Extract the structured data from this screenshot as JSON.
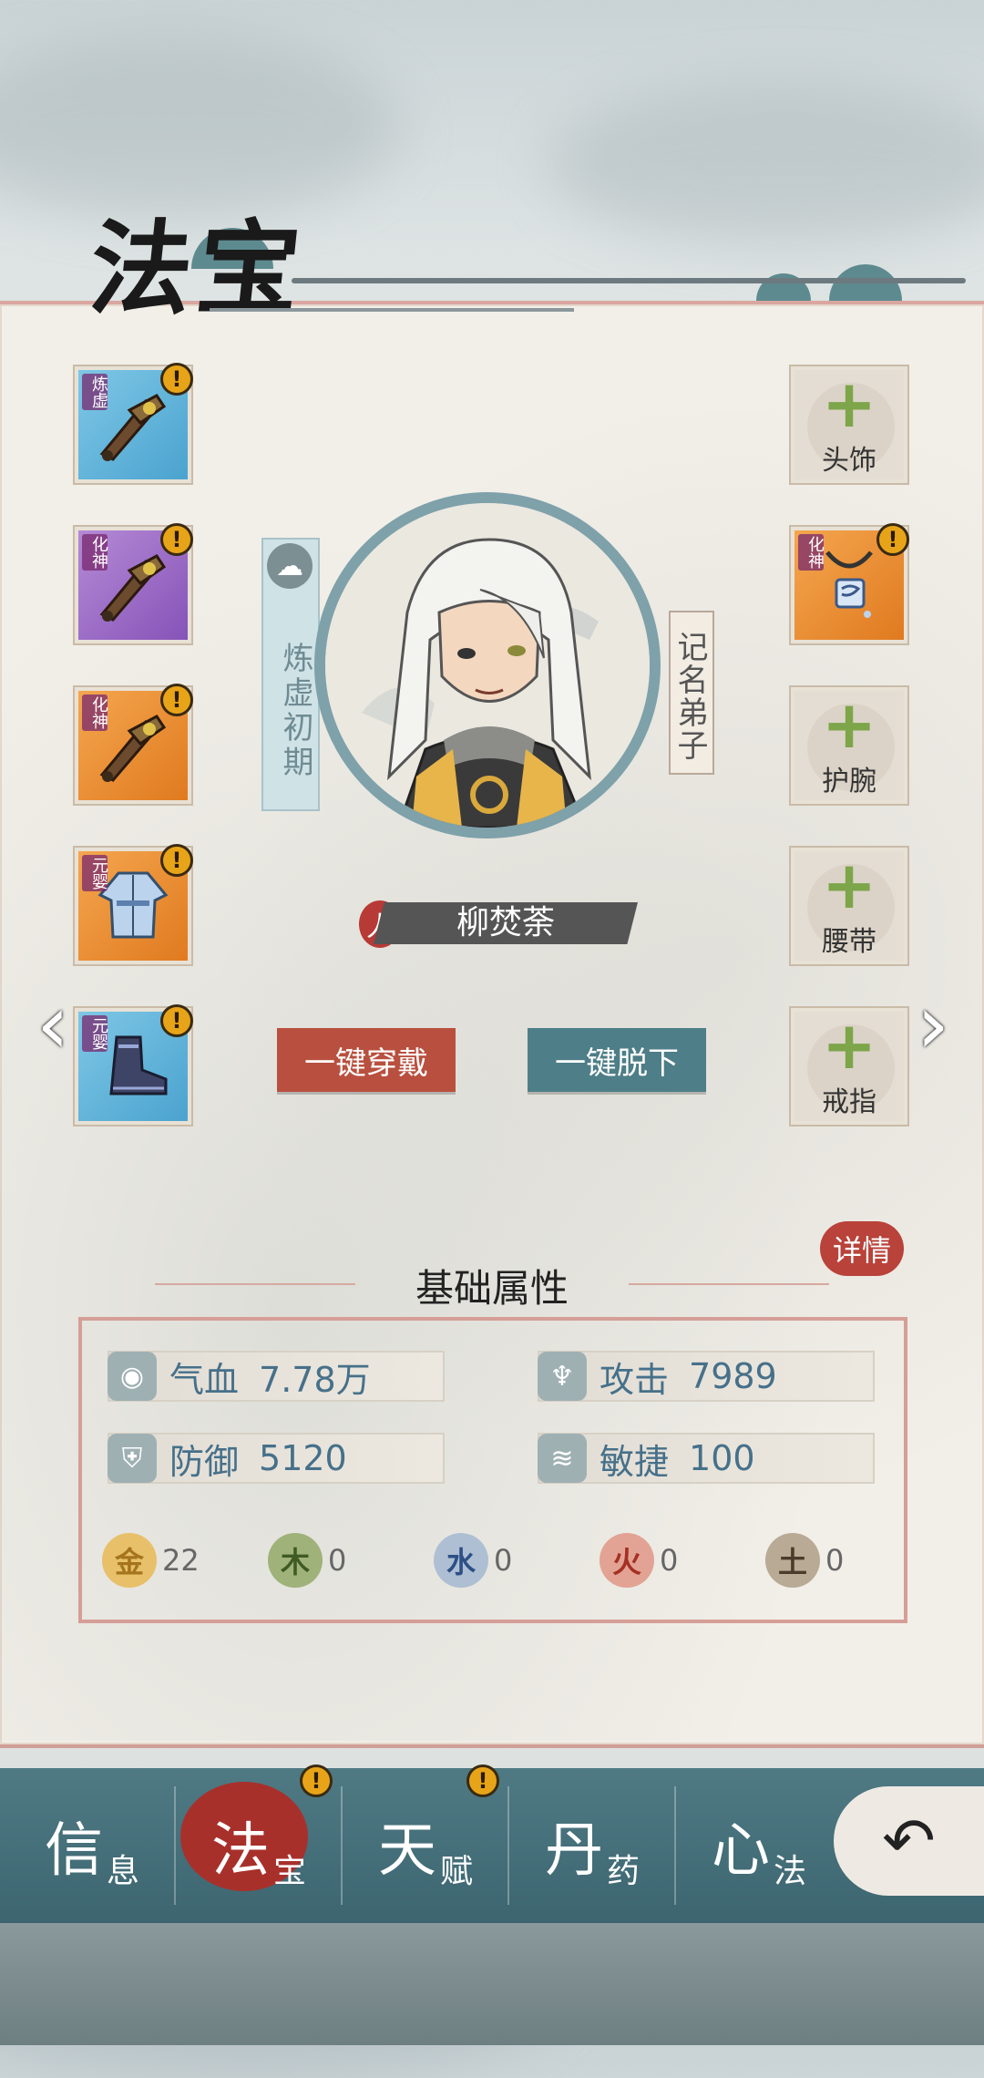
{
  "title": "法宝",
  "left_slots": [
    {
      "rank": "炼虚",
      "color": "blue",
      "item": "sword",
      "alert": "!"
    },
    {
      "rank": "化神",
      "color": "purple",
      "item": "sword",
      "alert": "!"
    },
    {
      "rank": "化神",
      "color": "orange",
      "item": "sword",
      "alert": "!"
    },
    {
      "rank": "元婴",
      "color": "orange",
      "item": "robe",
      "alert": "!"
    },
    {
      "rank": "元婴",
      "color": "blue",
      "item": "boots",
      "alert": "!"
    }
  ],
  "right_slots": [
    {
      "label": "头饰",
      "empty": true
    },
    {
      "rank": "化神",
      "color": "orange",
      "item": "pendant",
      "alert": "!"
    },
    {
      "label": "护腕",
      "empty": true
    },
    {
      "label": "腰带",
      "empty": true
    },
    {
      "label": "戒指",
      "empty": true
    }
  ],
  "character": {
    "realm": "炼虚初期",
    "title": "记名弟子",
    "name": "柳焚荼",
    "seal": "人"
  },
  "buttons": {
    "equip_all": "一键穿戴",
    "unequip_all": "一键脱下"
  },
  "attributes": {
    "section_title": "基础属性",
    "details_label": "详情",
    "hp": {
      "label": "气血",
      "value": "7.78万"
    },
    "attack": {
      "label": "攻击",
      "value": "7989"
    },
    "defense": {
      "label": "防御",
      "value": "5120"
    },
    "agility": {
      "label": "敏捷",
      "value": "100"
    },
    "elements": [
      {
        "glyph": "金",
        "value": "22",
        "bg": "#e8c06a",
        "fg": "#a5741c"
      },
      {
        "glyph": "木",
        "value": "0",
        "bg": "#9fb27a",
        "fg": "#3f5a24"
      },
      {
        "glyph": "水",
        "value": "0",
        "bg": "#aebfd3",
        "fg": "#2c4f86"
      },
      {
        "glyph": "火",
        "value": "0",
        "bg": "#e3a394",
        "fg": "#a53024"
      },
      {
        "glyph": "土",
        "value": "0",
        "bg": "#b8aa95",
        "fg": "#4a3c2a"
      }
    ]
  },
  "nav": [
    {
      "big": "信",
      "small": "息"
    },
    {
      "big": "法",
      "small": "宝",
      "active": true,
      "alert": "!"
    },
    {
      "big": "天",
      "small": "赋",
      "alert": "!"
    },
    {
      "big": "丹",
      "small": "药"
    },
    {
      "big": "心",
      "small": "法"
    }
  ],
  "back_glyph": "↶",
  "left_arrow": "‹",
  "right_arrow": "›"
}
